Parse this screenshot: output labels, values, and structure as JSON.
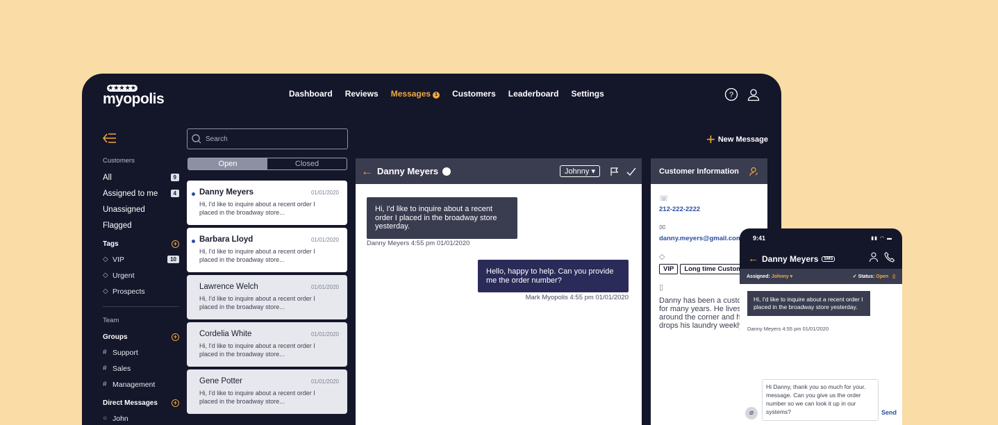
{
  "brand": {
    "stars": "★★★★★",
    "name": "myopolis"
  },
  "nav": {
    "items": [
      "Dashboard",
      "Reviews",
      "Messages",
      "Customers",
      "Leaderboard",
      "Settings"
    ],
    "active": "Messages",
    "badge": "1"
  },
  "sidebar": {
    "customers_label": "Customers",
    "filters": [
      {
        "label": "All",
        "count": "9"
      },
      {
        "label": "Assigned to me",
        "count": "4"
      },
      {
        "label": "Unassigned",
        "count": ""
      },
      {
        "label": "Flagged",
        "count": ""
      }
    ],
    "tags_label": "Tags",
    "tags": [
      {
        "label": "VIP",
        "count": "10"
      },
      {
        "label": "Urgent"
      },
      {
        "label": "Prospects"
      }
    ],
    "team_label": "Team",
    "groups_label": "Groups",
    "groups": [
      "Support",
      "Sales",
      "Management"
    ],
    "dm_label": "Direct Messages",
    "dms": [
      "John"
    ]
  },
  "search": {
    "placeholder": "Search"
  },
  "tabs": {
    "open": "Open",
    "closed": "Closed"
  },
  "conversations": [
    {
      "name": "Danny Meyers",
      "date": "01/01/2020",
      "preview": "Hi, I'd like to inquire about a recent order I placed in the broadway store...",
      "unread": true
    },
    {
      "name": "Barbara Lloyd",
      "date": "01/01/2020",
      "preview": "Hi, I'd like to inquire about a recent order I placed in the broadway store...",
      "unread": true
    },
    {
      "name": "Lawrence Welch",
      "date": "01/01/2020",
      "preview": "Hi, I'd like to inquire about a recent order I placed in the broadway store...",
      "unread": false
    },
    {
      "name": "Cordelia White",
      "date": "01/01/2020",
      "preview": "Hi, I'd like to inquire about a recent order I placed in the broadway store...",
      "unread": false
    },
    {
      "name": "Gene Potter",
      "date": "01/01/2020",
      "preview": "Hi, I'd like to inquire about a recent order I placed in the broadway store...",
      "unread": false
    }
  ],
  "new_message": "New Message",
  "chat": {
    "contact": "Danny Meyers",
    "assignee": "Johnny ▾",
    "incoming": "Hi, I'd like to inquire about a recent order I placed in the broadway store yesterday.",
    "incoming_meta": "Danny Meyers 4:55 pm 01/01/2020",
    "outgoing": "Hello, happy to help. Can you provide me the order number?",
    "outgoing_meta": "Mark Myopolis 4:55 pm 01/01/2020"
  },
  "customer_info": {
    "title": "Customer Information",
    "phone": "212-222-2222",
    "email": "danny.meyers@gmail.com",
    "tags": [
      "VIP",
      "Long time Customer"
    ],
    "note": "Danny has been a customer for many years. He lives around the corner and he drops his laundry weekly."
  },
  "mobile": {
    "time": "9:41",
    "contact": "Danny Meyers",
    "channel": "SMS",
    "assigned_label": "Assigned:",
    "assigned_value": "Johnny ▾",
    "status_label": "Status:",
    "status_value": "Open",
    "incoming": "Hi, I'd like to inquire about a recent order I placed in the broadway store yesterday.",
    "incoming_meta": "Danny Meyers 4:55 pm 01/01/2020",
    "draft": "Hi Danny, thank you so much for your. message. Can you give us the order number so we can look it up in our systems?",
    "send": "Send"
  }
}
